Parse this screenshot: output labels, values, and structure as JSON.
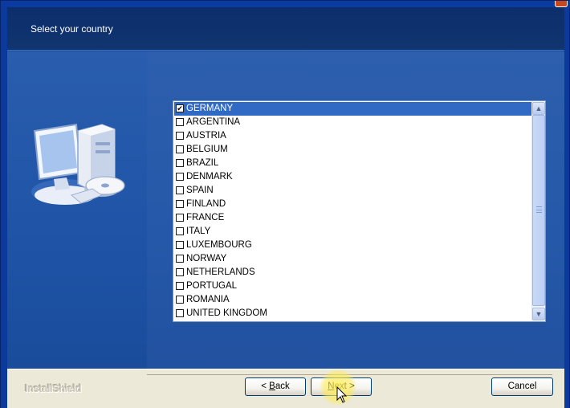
{
  "header": {
    "title": "Select your country"
  },
  "country_list": {
    "items": [
      {
        "label": "GERMANY",
        "checked": true,
        "selected": true
      },
      {
        "label": "ARGENTINA",
        "checked": false
      },
      {
        "label": "AUSTRIA",
        "checked": false
      },
      {
        "label": "BELGIUM",
        "checked": false
      },
      {
        "label": "BRAZIL",
        "checked": false
      },
      {
        "label": "DENMARK",
        "checked": false
      },
      {
        "label": "SPAIN",
        "checked": false
      },
      {
        "label": "FINLAND",
        "checked": false
      },
      {
        "label": "FRANCE",
        "checked": false
      },
      {
        "label": "ITALY",
        "checked": false
      },
      {
        "label": "LUXEMBOURG",
        "checked": false
      },
      {
        "label": "NORWAY",
        "checked": false
      },
      {
        "label": "NETHERLANDS",
        "checked": false
      },
      {
        "label": "PORTUGAL",
        "checked": false
      },
      {
        "label": "ROMANIA",
        "checked": false
      },
      {
        "label": "UNITED KINGDOM",
        "checked": false
      }
    ]
  },
  "footer": {
    "brand": "InstallShield",
    "back_button": {
      "prefix": "< ",
      "mnemonic": "B",
      "rest": "ack"
    },
    "next_button": {
      "mnemonic": "N",
      "rest": "ext >"
    },
    "cancel_button": "Cancel"
  },
  "icons": {
    "scroll_up": "chevron-up-icon",
    "scroll_down": "chevron-down-icon",
    "computer": "computer-icon",
    "cursor": "mouse-cursor-icon"
  },
  "colors": {
    "window_blue": "#1b4f9c",
    "header_navy": "#0d2e6c",
    "selection": "#316ac5",
    "footer_bg": "#ece9d8"
  }
}
